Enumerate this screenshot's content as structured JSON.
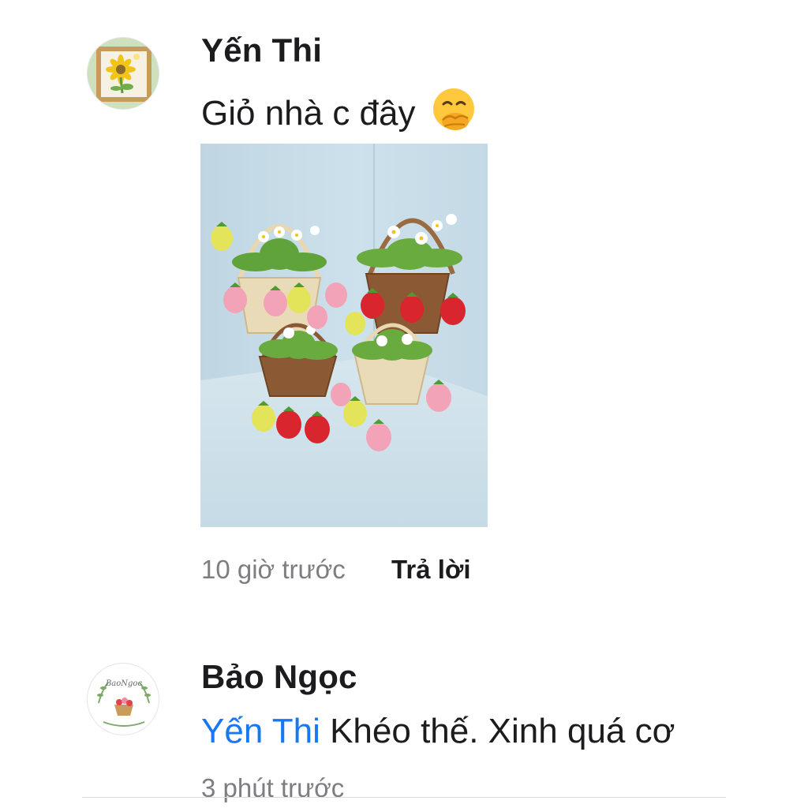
{
  "comments": [
    {
      "author": "Yến Thi",
      "text": "Giỏ nhà c đây",
      "emoji": "🤭",
      "emoji_name": "face-with-hand-over-mouth-icon",
      "time": "10 giờ trước",
      "reply_label": "Trả lời",
      "avatar_name": "sunflower-frame-avatar"
    },
    {
      "author": "Bảo Ngọc",
      "mention": "Yến Thi",
      "text": "Khéo thế. Xinh quá cơ",
      "time": "3 phút trước",
      "avatar_logo_text": "BaoNgoc",
      "avatar_name": "shop-logo-avatar"
    }
  ],
  "colors": {
    "mention": "#1877f2",
    "meta": "#7d7d82",
    "photo_background": "#c9dde8"
  }
}
